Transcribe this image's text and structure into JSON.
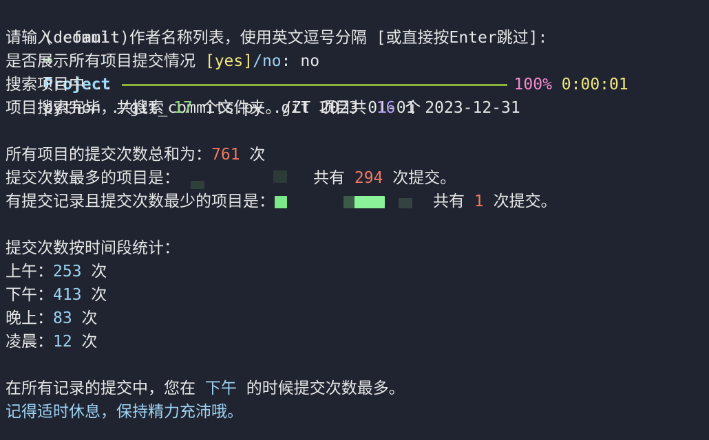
{
  "prompt": {
    "env": "(default)",
    "arrow": "➜",
    "dir": "Project",
    "command": "python ./git_commits.py ./ZT 2023-01-01 2023-12-31"
  },
  "lines": {
    "author_prompt": "请输入 commit 作者名称列表，使用英文逗号分隔 [或直接按Enter跳过]:",
    "show_prompt_prefix": "是否展示所有项目提交情况 ",
    "show_prompt_yes": "[yes]",
    "show_prompt_no": "/no",
    "show_prompt_sep": ": ",
    "show_prompt_answer": "no",
    "searching_label": "搜索项目中...",
    "progress_percent": "100%",
    "progress_time": "0:00:01",
    "search_done_a": "项目搜索完毕，共搜索 ",
    "folder_count": "17",
    "search_done_b": " 个文件夹。git 项目共 ",
    "git_count": "16",
    "search_done_c": " 个",
    "total_a": "所有项目的提交次数总和为：",
    "total_commits": "761",
    "total_b": " 次",
    "most_a": "提交次数最多的项目是：",
    "most_b": "共有 ",
    "most_commits": "294",
    "most_c": " 次提交。",
    "least_a": "有提交记录且提交次数最少的项目是：",
    "least_b": "共有 ",
    "least_commits": "1",
    "least_c": " 次提交。",
    "period_header": "提交次数按时间段统计：",
    "periods": [
      {
        "label": "上午：",
        "value": "253",
        "unit": " 次"
      },
      {
        "label": "下午：",
        "value": "413",
        "unit": " 次"
      },
      {
        "label": "晚上：",
        "value": "83",
        "unit": " 次"
      },
      {
        "label": "凌晨：",
        "value": "12",
        "unit": " 次"
      }
    ],
    "summary_a": "在所有记录的提交中，您在 ",
    "summary_period": "下午",
    "summary_b": " 的时候提交次数最多。",
    "advice": "记得适时休息，保持精力充沛哦。"
  },
  "progress": 1.0,
  "colors": {
    "background": "#1f2430",
    "progress_bar": "#8fb33a",
    "highlight_green": "#8fdd7f",
    "highlight_red": "#f07862"
  }
}
